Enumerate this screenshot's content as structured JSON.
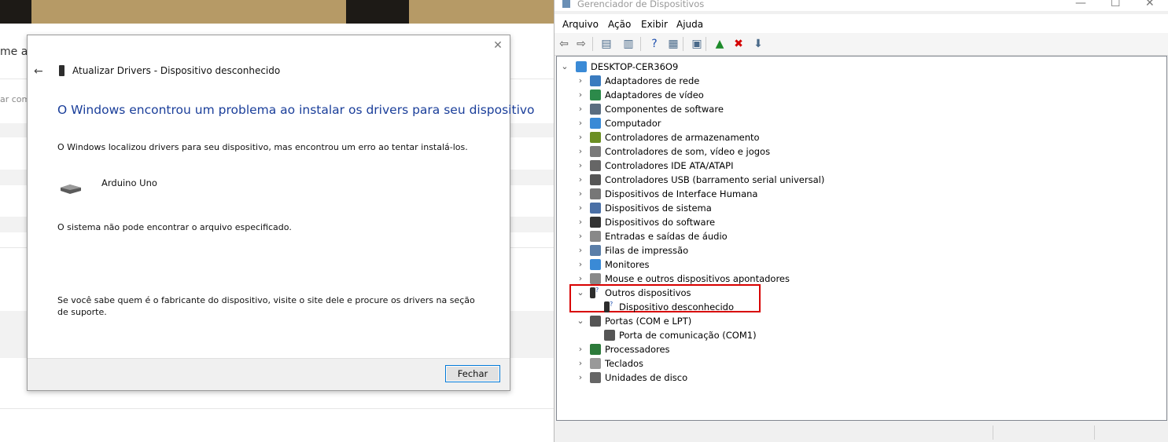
{
  "background_page": {
    "fragment_1": "me aj",
    "fragment_2": "ar com"
  },
  "dialog": {
    "close_glyph": "✕",
    "back_glyph": "←",
    "title": "Atualizar Drivers - Dispositivo desconhecido",
    "heading": "O Windows encontrou um problema ao instalar os drivers para seu dispositivo",
    "message": "O Windows localizou drivers para seu dispositivo, mas encontrou um erro ao tentar instalá-los.",
    "device_name": "Arduino Uno",
    "error": "O sistema não pode encontrar o arquivo especificado.",
    "hint_line1": "Se você sabe quem é o fabricante do dispositivo, visite o site dele e procure os drivers na seção",
    "hint_line2": "de suporte.",
    "close_button": "Fechar"
  },
  "device_manager": {
    "title": "Gerenciador de Dispositivos",
    "window_controls": {
      "minimize": "—",
      "maximize": "☐",
      "close": "✕"
    },
    "menu": [
      "Arquivo",
      "Ação",
      "Exibir",
      "Ajuda"
    ],
    "toolbar": [
      {
        "name": "back-icon",
        "glyph": "⇦"
      },
      {
        "name": "forward-icon",
        "glyph": "⇨"
      },
      {
        "name": "show-hide-tree-icon",
        "glyph": "▤"
      },
      {
        "name": "properties-icon",
        "glyph": "▥"
      },
      {
        "name": "help-icon",
        "glyph": "?"
      },
      {
        "name": "action-pane-icon",
        "glyph": "▦"
      },
      {
        "name": "scan-hardware-icon",
        "glyph": "▣"
      },
      {
        "name": "update-driver-icon",
        "glyph": "▲"
      },
      {
        "name": "uninstall-icon",
        "glyph": "✖"
      },
      {
        "name": "download-icon",
        "glyph": "⬇"
      }
    ],
    "tree": {
      "root": "DESKTOP-CER36O9",
      "categories": [
        {
          "label": "Adaptadores de rede",
          "expanded": false,
          "icon": "network-adapter-icon"
        },
        {
          "label": "Adaptadores de vídeo",
          "expanded": false,
          "icon": "display-adapter-icon"
        },
        {
          "label": "Componentes de software",
          "expanded": false,
          "icon": "software-component-icon"
        },
        {
          "label": "Computador",
          "expanded": false,
          "icon": "computer-icon"
        },
        {
          "label": "Controladores de armazenamento",
          "expanded": false,
          "icon": "storage-controller-icon"
        },
        {
          "label": "Controladores de som, vídeo e jogos",
          "expanded": false,
          "icon": "sound-icon"
        },
        {
          "label": "Controladores IDE ATA/ATAPI",
          "expanded": false,
          "icon": "ide-icon"
        },
        {
          "label": "Controladores USB (barramento serial universal)",
          "expanded": false,
          "icon": "usb-icon"
        },
        {
          "label": "Dispositivos de Interface Humana",
          "expanded": false,
          "icon": "hid-icon"
        },
        {
          "label": "Dispositivos de sistema",
          "expanded": false,
          "icon": "system-device-icon"
        },
        {
          "label": "Dispositivos do software",
          "expanded": false,
          "icon": "software-device-icon"
        },
        {
          "label": "Entradas e saídas de áudio",
          "expanded": false,
          "icon": "audio-io-icon"
        },
        {
          "label": "Filas de impressão",
          "expanded": false,
          "icon": "printer-icon"
        },
        {
          "label": "Monitores",
          "expanded": false,
          "icon": "monitor-icon"
        },
        {
          "label": "Mouse e outros dispositivos apontadores",
          "expanded": false,
          "icon": "mouse-icon"
        },
        {
          "label": "Outros dispositivos",
          "expanded": true,
          "icon": "unknown-device-icon",
          "children": [
            {
              "label": "Dispositivo desconhecido",
              "icon": "unknown-device-icon"
            }
          ]
        },
        {
          "label": "Portas (COM e LPT)",
          "expanded": true,
          "icon": "port-icon",
          "children": [
            {
              "label": "Porta de comunicação (COM1)",
              "icon": "port-icon"
            }
          ]
        },
        {
          "label": "Processadores",
          "expanded": false,
          "icon": "processor-icon"
        },
        {
          "label": "Teclados",
          "expanded": false,
          "icon": "keyboard-icon"
        },
        {
          "label": "Unidades de disco",
          "expanded": false,
          "icon": "disk-icon"
        }
      ]
    },
    "highlight_color": "#d80000"
  }
}
